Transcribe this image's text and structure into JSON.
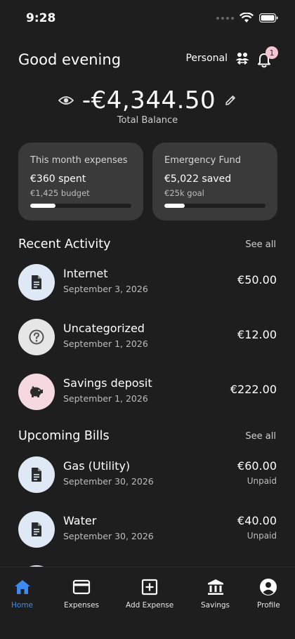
{
  "status_bar": {
    "time": "9:28"
  },
  "header": {
    "greeting": "Good evening",
    "workspace": "Personal",
    "notification_count": "1"
  },
  "balance": {
    "amount": "-€4,344.50",
    "caption": "Total Balance"
  },
  "cards": [
    {
      "title": "This month expenses",
      "value": "€360 spent",
      "sub": "€1,425 budget",
      "progress": 0.25
    },
    {
      "title": "Emergency Fund",
      "value": "€5,022 saved",
      "sub": "€25k goal",
      "progress": 0.2
    }
  ],
  "recent": {
    "title": "Recent Activity",
    "see_all": "See all",
    "items": [
      {
        "title": "Internet",
        "date": "September 3, 2026",
        "amount": "€50.00",
        "icon": "document-icon",
        "icon_bg": "#dfe9f6"
      },
      {
        "title": "Uncategorized",
        "date": "September 1, 2026",
        "amount": "€12.00",
        "icon": "question-icon",
        "icon_bg": "#e6e6e6"
      },
      {
        "title": "Savings deposit",
        "date": "September 1, 2026",
        "amount": "€222.00",
        "icon": "piggy-bank-icon",
        "icon_bg": "#f6d9e0"
      }
    ]
  },
  "bills": {
    "title": "Upcoming Bills",
    "see_all": "See all",
    "items": [
      {
        "title": "Gas (Utility)",
        "date": "September 30, 2026",
        "amount": "€60.00",
        "status": "Unpaid",
        "icon": "document-icon"
      },
      {
        "title": "Water",
        "date": "September 30, 2026",
        "amount": "€40.00",
        "status": "Unpaid",
        "icon": "document-icon"
      }
    ]
  },
  "nav": {
    "items": [
      {
        "label": "Home",
        "icon": "home-icon",
        "active": true
      },
      {
        "label": "Expenses",
        "icon": "credit-card-icon",
        "active": false
      },
      {
        "label": "Add Expense",
        "icon": "add-box-icon",
        "active": false
      },
      {
        "label": "Savings",
        "icon": "bank-icon",
        "active": false
      },
      {
        "label": "Profile",
        "icon": "account-icon",
        "active": false
      }
    ]
  },
  "colors": {
    "background": "#1e1e1e",
    "card": "#3a3a3a",
    "accent": "#3d8bf0",
    "badge": "#f5c6d0"
  }
}
